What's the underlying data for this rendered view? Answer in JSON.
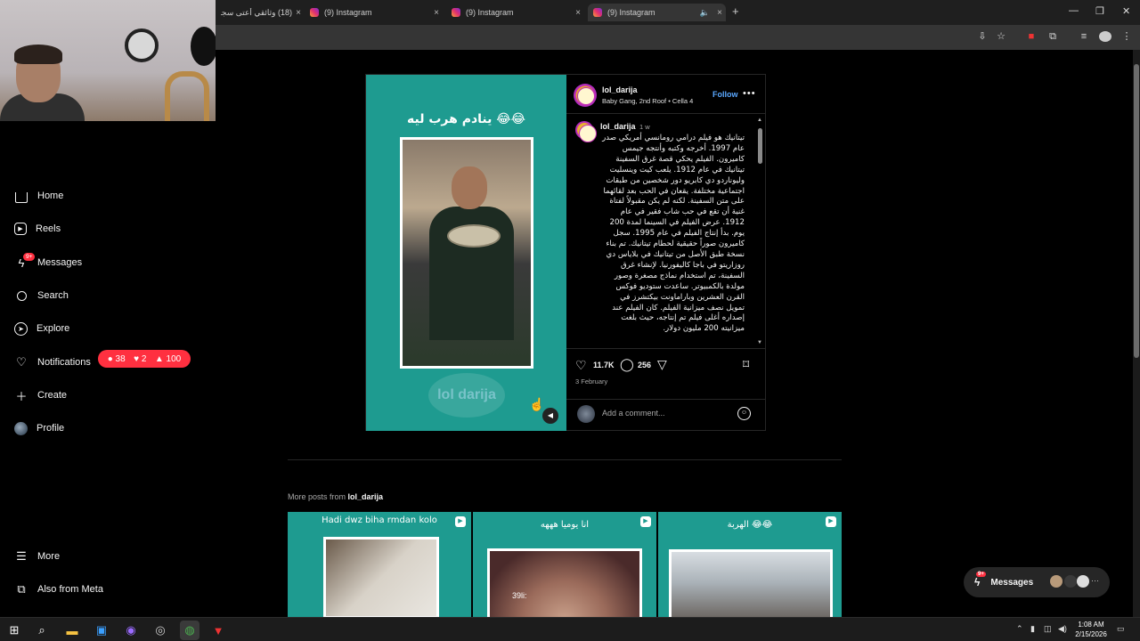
{
  "browser": {
    "tabs": [
      {
        "title": "(18) وثائقي أعتى سجون"
      },
      {
        "title": "(9) Instagram"
      },
      {
        "title": "(9) Instagram"
      },
      {
        "title": "(9) Instagram"
      }
    ],
    "close_glyph": "×",
    "new_tab_glyph": "+",
    "mute_glyph": "🔈"
  },
  "sidebar": {
    "items": [
      {
        "label": "Home",
        "icon": "home-icon"
      },
      {
        "label": "Reels",
        "icon": "reels-icon"
      },
      {
        "label": "Messages",
        "icon": "messenger-icon",
        "badge": "9+"
      },
      {
        "label": "Search",
        "icon": "search-icon"
      },
      {
        "label": "Explore",
        "icon": "compass-icon"
      },
      {
        "label": "Notifications",
        "icon": "heart-icon"
      },
      {
        "label": "Create",
        "icon": "plus-icon"
      },
      {
        "label": "Profile",
        "icon": "avatar"
      }
    ],
    "bottom": [
      {
        "label": "More",
        "icon": "menu-icon"
      },
      {
        "label": "Also from Meta",
        "icon": "meta-icon"
      }
    ],
    "notification_counts": {
      "comments": "38",
      "likes": "2",
      "follows": "100"
    }
  },
  "post": {
    "media_caption": "ينادم هرب ليه 😂😂",
    "watermark": "lol darija",
    "username": "lol_darija",
    "location": "Baby Gang, 2nd Roof • Cella 4",
    "follow_label": "Follow",
    "more_glyph": "•••",
    "comment_user": "lol_darija",
    "comment_time": "1 w",
    "caption": "تيتانيك هو فيلم درامي رومانسي أمريكي صدر عام 1997. أخرجه وكتبه وأنتجه جيمس كاميرون. الفيلم يحكي قصة غرق السفينة تيتانيك في عام 1912. يلعب كيت وينسليت وليوناردو دي كابريو دور شخصين من طبقات اجتماعية مختلفة. يقعان في الحب بعد لقائهما على متن السفينة. لكنه لم يكن مقبولاً لفتاة غنية أن تقع في حب شاب فقير في عام 1912. عرض الفيلم في السينما لمدة 200 يوم. بدأ إنتاج الفيلم في عام 1995. سجل كاميرون صوراً حقيقية لحطام تيتانيك. تم بناء نسخة طبق الأصل من تيتانيك في بلاياس دي روزاريتو في باجا كاليفورنيا. لإنشاء غرق السفينة، تم استخدام نماذج مصغرة وصور مولدة بالكمبيوتر. ساعدت ستوديو فوكس القرن العشرين وباراماونت بيكتشرز في تمويل نصف ميزانية الفيلم. كان الفيلم عند إصداره أغلى فيلم تم إنتاجه، حيث بلغت ميزانيته 200 مليون دولار.",
    "likes": "11.7K",
    "comments": "256",
    "date": "3 February",
    "add_comment_placeholder": "Add a comment..."
  },
  "more_posts": {
    "prefix": "More posts from",
    "user": "lol_darija",
    "items": [
      {
        "caption": "Hadi dwz biha rmdan kolo"
      },
      {
        "caption": "انا يوميا هههه",
        "tag": "39li:"
      },
      {
        "caption": "الهربة 😂😂"
      }
    ]
  },
  "messages_pill": {
    "label": "Messages",
    "badge": "9+"
  },
  "taskbar": {
    "time": "1:08 AM",
    "date": "2/15/2026"
  }
}
